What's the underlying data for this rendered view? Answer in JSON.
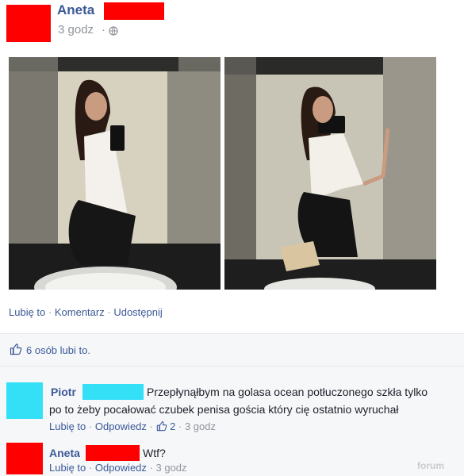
{
  "post": {
    "author_name": "Aneta",
    "timestamp": "3 godz",
    "privacy_icon": "globe-icon",
    "actions": [
      "Lubię to",
      "Komentarz",
      "Udostępnij"
    ],
    "action_separator": "·",
    "likes_summary": "6 osób lubi to."
  },
  "comments": [
    {
      "author": "Piotr",
      "text_line1": "Przepłynąłbym na golasa ocean potłuczonego szkła tylko",
      "text_line2": "po to żeby pocałować czubek penisa gościa który cię ostatnio wyruchał",
      "like_label": "Lubię to",
      "reply_label": "Odpowiedz",
      "like_count": "2",
      "time": "3 godz"
    },
    {
      "author": "Aneta",
      "text": "Wtf?",
      "like_label": "Lubię to",
      "reply_label": "Odpowiedz",
      "time": "3 godz"
    }
  ],
  "watermark": "forum",
  "colors": {
    "redaction_red": "#ff0000",
    "redaction_cyan": "#33e0f5",
    "link_blue": "#3b5998",
    "muted_gray": "#90949c"
  }
}
